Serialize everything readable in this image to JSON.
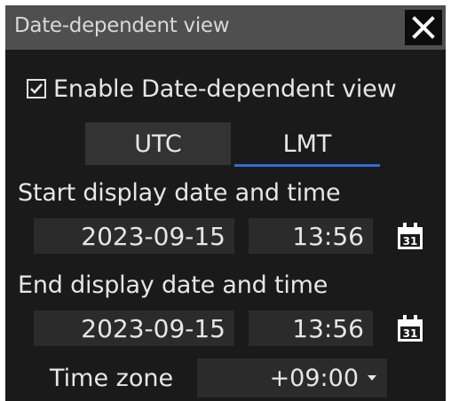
{
  "window": {
    "title": "Date-dependent view",
    "close_icon": "close-icon"
  },
  "enable": {
    "label": "Enable Date-dependent view",
    "checked": true
  },
  "tabs": [
    {
      "label": "UTC",
      "selected": false
    },
    {
      "label": "LMT",
      "selected": true
    }
  ],
  "start": {
    "label": "Start display date and time",
    "date": "2023-09-15",
    "time": "13:56",
    "calendar_day": "31"
  },
  "end": {
    "label": "End display date and time",
    "date": "2023-09-15",
    "time": "13:56",
    "calendar_day": "31"
  },
  "timezone": {
    "label": "Time zone",
    "value": "+09:00"
  },
  "colors": {
    "background": "#1a1a1a",
    "titlebar": "#4f4f4f",
    "field": "#2b2b2b",
    "accent": "#2f6fd6",
    "text": "#e6e6e6"
  }
}
